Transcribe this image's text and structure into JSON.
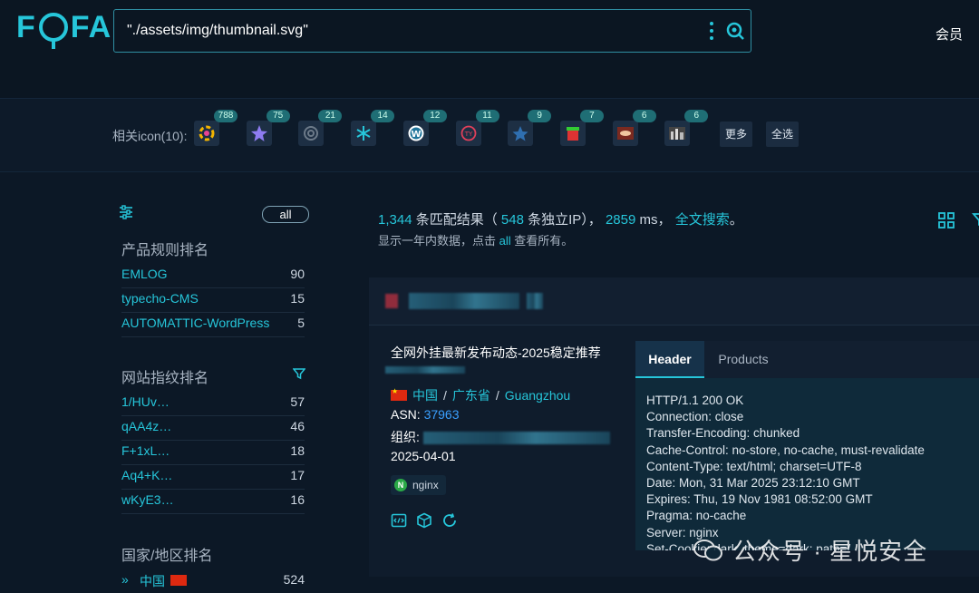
{
  "header": {
    "logo": "FOFA",
    "search_query": "\"./assets/img/thumbnail.svg\"",
    "member_label": "会员"
  },
  "icon_bar": {
    "label": "相关icon(10):",
    "icons": [
      {
        "name": "colorful-wheel-icon",
        "count": "788"
      },
      {
        "name": "star-shape-icon",
        "count": "75"
      },
      {
        "name": "gear-circle-icon",
        "count": "21"
      },
      {
        "name": "snowflake-icon",
        "count": "14"
      },
      {
        "name": "wordpress-icon",
        "count": "12"
      },
      {
        "name": "ty-circle-icon",
        "count": "11"
      },
      {
        "name": "dark-star-icon",
        "count": "9"
      },
      {
        "name": "box-red-icon",
        "count": "7"
      },
      {
        "name": "photo-thumbnail-icon",
        "count": "6"
      },
      {
        "name": "city-thumbnail-icon",
        "count": "6"
      }
    ],
    "more_label": "更多",
    "select_all_label": "全选"
  },
  "sidebar": {
    "all_label": "all",
    "product_title": "产品规则排名",
    "products": [
      {
        "name": "EMLOG",
        "count": "90"
      },
      {
        "name": "typecho-CMS",
        "count": "15"
      },
      {
        "name": "AUTOMATTIC-WordPress",
        "count": "5"
      }
    ],
    "fingerprint_title": "网站指纹排名",
    "fingerprints": [
      {
        "name": "1/HUv…",
        "count": "57"
      },
      {
        "name": "qAA4z…",
        "count": "46"
      },
      {
        "name": "F+1xL…",
        "count": "18"
      },
      {
        "name": "Aq4+K…",
        "count": "17"
      },
      {
        "name": "wKyE3…",
        "count": "16"
      }
    ],
    "country_title": "国家/地区排名",
    "countries": [
      {
        "name": "中国",
        "count": "524"
      }
    ]
  },
  "summary": {
    "results": "1,344",
    "results_text": "条匹配结果（",
    "ips": "548",
    "ips_text": "条独立IP），",
    "ms": "2859",
    "ms_text": "ms，",
    "fulltext": "全文搜索",
    "period": "。",
    "sub_prefix": "显示一年内数据，点击",
    "sub_all": "all",
    "sub_suffix": "查看所有。"
  },
  "result": {
    "title": "全网外挂最新发布动态-2025稳定推荐",
    "country": "中国",
    "province": "广东省",
    "city": "Guangzhou",
    "asn_label": "ASN:",
    "asn": "37963",
    "org_label": "组织:",
    "date": "2025-04-01",
    "server_tag": "nginx",
    "tabs": [
      "Header",
      "Products"
    ],
    "http_header": [
      "HTTP/1.1 200 OK",
      "Connection: close",
      "Transfer-Encoding: chunked",
      "Cache-Control: no-store, no-cache, must-revalidate",
      "Content-Type: text/html; charset=UTF-8",
      "Date: Mon, 31 Mar 2025 23:12:10 GMT",
      "Expires: Thu, 19 Nov 1981 08:52:00 GMT",
      "Pragma: no-cache",
      "Server: nginx",
      "Set-Cookie: dark_theme=dark; path=/"
    ]
  },
  "watermark": "公众号 · 星悦安全",
  "colors": {
    "accent": "#26c6da",
    "background": "#0c1826",
    "link": "#3aa0ff"
  }
}
